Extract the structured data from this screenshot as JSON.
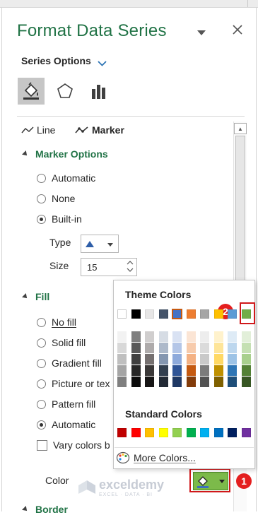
{
  "pane": {
    "title": "Format Data Series",
    "series_options_label": "Series Options",
    "subtabs": {
      "line": "Line",
      "marker": "Marker"
    }
  },
  "marker_options": {
    "header": "Marker Options",
    "options": [
      "Automatic",
      "None",
      "Built-in"
    ],
    "selected": "Built-in",
    "type_label": "Type",
    "size_label": "Size",
    "size_value": "15"
  },
  "fill": {
    "header": "Fill",
    "options": [
      "No fill",
      "Solid fill",
      "Gradient fill",
      "Picture or tex",
      "Pattern fill",
      "Automatic"
    ],
    "selected": "Automatic",
    "vary_colors": "Vary colors b",
    "color_label": "Color",
    "color_value": "#7cba4a"
  },
  "border_header": "Border",
  "color_picker": {
    "theme_title": "Theme Colors",
    "standard_title": "Standard Colors",
    "more_colors": "More Colors...",
    "theme_colors": [
      "#ffffff",
      "#000000",
      "#e7e6e6",
      "#44546a",
      "#4472c4",
      "#ed7d31",
      "#a5a5a5",
      "#ffc000",
      "#5b9bd5",
      "#70ad47"
    ],
    "theme_shades": [
      [
        "#f2f2f2",
        "#7f7f7f",
        "#d0cece",
        "#d6dce4",
        "#d9e2f3",
        "#fbe5d5",
        "#ededed",
        "#fff2cc",
        "#deebf6",
        "#e2efd9"
      ],
      [
        "#d8d8d8",
        "#595959",
        "#aeabab",
        "#adb9ca",
        "#b4c6e7",
        "#f7cbac",
        "#dbdbdb",
        "#fee599",
        "#bdd7ee",
        "#c5e0b3"
      ],
      [
        "#bfbfbf",
        "#3f3f3f",
        "#757070",
        "#8496b0",
        "#8eaadb",
        "#f4b183",
        "#c9c9c9",
        "#ffd965",
        "#9dc3e6",
        "#a8d08d"
      ],
      [
        "#a5a5a5",
        "#262626",
        "#3a3838",
        "#323f4f",
        "#2f5496",
        "#c55a11",
        "#7b7b7b",
        "#bf9000",
        "#2e75b5",
        "#538135"
      ],
      [
        "#7f7f7f",
        "#0c0c0c",
        "#171616",
        "#222a35",
        "#1f3864",
        "#833c0b",
        "#525252",
        "#7f6000",
        "#1e4e79",
        "#375623"
      ]
    ],
    "standard_colors": [
      "#c00000",
      "#ff0000",
      "#ffc000",
      "#ffff00",
      "#92d050",
      "#00b050",
      "#00b0f0",
      "#0070c0",
      "#002060",
      "#7030a0"
    ]
  },
  "callouts": {
    "one": "1",
    "two": "2"
  },
  "watermark": {
    "name": "exceldemy",
    "tagline": "EXCEL · DATA · BI"
  }
}
